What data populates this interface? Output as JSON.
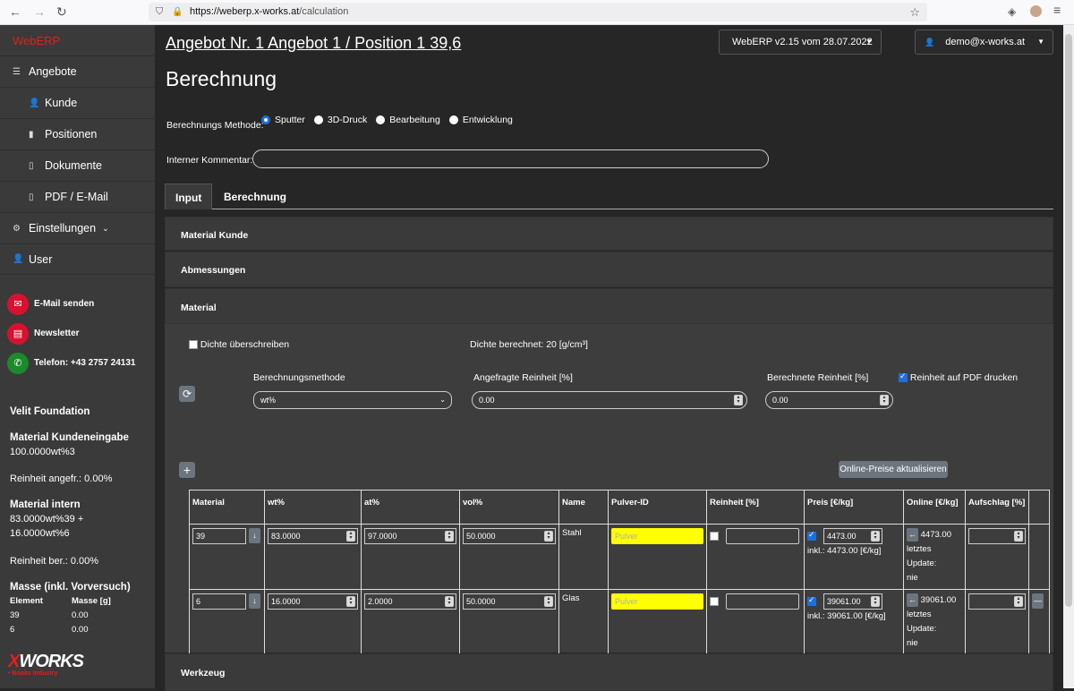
{
  "browser": {
    "url_host": "https://weberp.x-works.at",
    "url_path": "/calculation"
  },
  "sidebar": {
    "brand": "WebERP",
    "nav": [
      {
        "label": "Angebote",
        "icon": "list-icon"
      },
      {
        "label": "Kunde",
        "icon": "user-icon"
      },
      {
        "label": "Positionen",
        "icon": "bookmark-icon"
      },
      {
        "label": "Dokumente",
        "icon": "document-icon"
      },
      {
        "label": "PDF / E-Mail",
        "icon": "file-icon"
      },
      {
        "label": "Einstellungen",
        "icon": "gear-icon"
      },
      {
        "label": "User",
        "icon": "user-icon"
      }
    ],
    "email": "E-Mail senden",
    "newsletter": "Newsletter",
    "phone": "Telefon: +43 2757 24131",
    "foundation": "Velit Foundation",
    "mk_title": "Material Kundeneingabe",
    "mk_value": "100.0000wt%3",
    "reinheit_angefr": "Reinheit angefr.: 0.00%",
    "mi_title": "Material intern",
    "mi_line1": "83.0000wt%39 +",
    "mi_line2": "16.0000wt%6",
    "reinheit_ber": "Reinheit ber.: 0.00%",
    "masse_title": "Masse (inkl. Vorversuch)",
    "col_element": "Element",
    "col_masse": "Masse [g]",
    "masse_rows": [
      {
        "el": "39",
        "m": "0.00"
      },
      {
        "el": "6",
        "m": "0.00"
      }
    ],
    "logo_a": "X",
    "logo_b": "WORKS",
    "logo_sub": "• Books Industry"
  },
  "header": {
    "title": "Angebot Nr. 1 Angebot 1 / Position 1 39,6",
    "version": "WebERP v2.15 vom 28.07.2022",
    "user": "demo@x-works.at"
  },
  "page_title": "Berechnung",
  "methode_label": "Berechnungs Methode:",
  "methods": [
    "Sputter",
    "3D-Druck",
    "Bearbeitung",
    "Entwicklung"
  ],
  "kommentar_label": "Interner Kommentar:",
  "tabs": [
    "Input",
    "Berechnung"
  ],
  "panels": {
    "kunde": "Material Kunde",
    "abm": "Abmessungen",
    "material": "Material",
    "werkzeug": "Werkzeug"
  },
  "material": {
    "dichte_over": "Dichte überschreiben",
    "dichte_calc": "Dichte berechnet: 20 [g/cm³]",
    "methode_label": "Berechnungsmethode",
    "methode_value": "wt%",
    "angefragte_label": "Angefragte Reinheit [%]",
    "angefragte_value": "0.00",
    "berechnete_label": "Berechnete Reinheit [%]",
    "berechnete_value": "0.00",
    "pdf_label": "Reinheit auf PDF drucken",
    "online_btn": "Online-Preise aktualisieren",
    "headers": [
      "Material",
      "wt%",
      "at%",
      "vol%",
      "Name",
      "Pulver-ID",
      "Reinheit [%]",
      "Preis [€/kg]",
      "Online [€/kg]",
      "Aufschlag [%]"
    ],
    "rows": [
      {
        "material": "39",
        "wt": "83.0000",
        "at": "97.0000",
        "vol": "50.0000",
        "name": "Stahl",
        "pulver": "Pulver",
        "preis": "4473.00",
        "inkl": "inkl.: 4473.00 [€/kg]",
        "online": "4473.00",
        "letztes": "letztes",
        "update": "Update:",
        "nie": "nie"
      },
      {
        "material": "6",
        "wt": "16.0000",
        "at": "2.0000",
        "vol": "50.0000",
        "name": "Glas",
        "pulver": "Pulver",
        "preis": "39061.00",
        "inkl": "inkl.: 39061.00 [€/kg]",
        "online": "39061.00",
        "letztes": "letztes",
        "update": "Update:",
        "nie": "nie"
      }
    ]
  }
}
